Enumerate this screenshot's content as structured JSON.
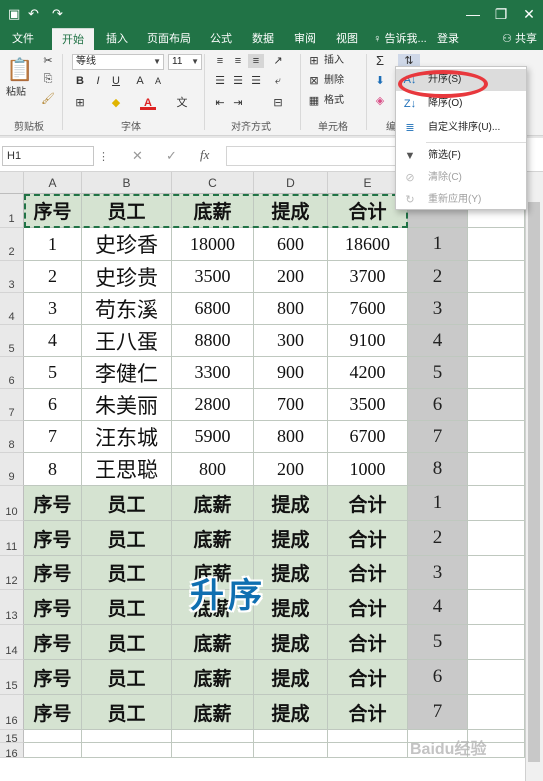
{
  "quick_access": {
    "undo": "↶",
    "redo": "↷",
    "save": "▣"
  },
  "window": {
    "minimize": "—",
    "restore": "❐",
    "close": "✕"
  },
  "tabs": [
    {
      "label": "文件"
    },
    {
      "label": "开始"
    },
    {
      "label": "插入"
    },
    {
      "label": "页面布局"
    },
    {
      "label": "公式"
    },
    {
      "label": "数据"
    },
    {
      "label": "审阅"
    },
    {
      "label": "视图"
    },
    {
      "label": "♀ 告诉我..."
    },
    {
      "label": "登录"
    }
  ],
  "share_label": "⚇ 共享",
  "ribbon": {
    "paste": "粘贴",
    "font_name": "等线",
    "font_size": "11",
    "insert": "插入",
    "delete": "删除",
    "format": "格式",
    "groups": {
      "clipboard": "剪贴板",
      "font": "字体",
      "alignment": "对齐方式",
      "cells": "单元格",
      "editing": "编"
    }
  },
  "formula_bar": {
    "name_box": "H1",
    "fx": "fx",
    "cancel": "✕",
    "enter": "✓"
  },
  "columns": [
    "A",
    "B",
    "C",
    "D",
    "E"
  ],
  "row_numbers": [
    "1",
    "2",
    "3",
    "4",
    "5",
    "6",
    "7",
    "8",
    "9",
    "10",
    "11",
    "12",
    "13",
    "14",
    "15",
    "16",
    "15",
    "16"
  ],
  "table": {
    "headers": [
      "序号",
      "员工",
      "底薪",
      "提成",
      "合计"
    ],
    "rows": [
      [
        "1",
        "史珍香",
        "18000",
        "600",
        "18600"
      ],
      [
        "2",
        "史珍贵",
        "3500",
        "200",
        "3700"
      ],
      [
        "3",
        "苟东溪",
        "6800",
        "800",
        "7600"
      ],
      [
        "4",
        "王八蛋",
        "8800",
        "300",
        "9100"
      ],
      [
        "5",
        "李健仁",
        "3300",
        "900",
        "4200"
      ],
      [
        "6",
        "朱美丽",
        "2800",
        "700",
        "3500"
      ],
      [
        "7",
        "汪东城",
        "5900",
        "800",
        "6700"
      ],
      [
        "8",
        "王思聪",
        "800",
        "200",
        "1000"
      ]
    ],
    "repeat_headers": [
      "序号",
      "员工",
      "底薪",
      "提成",
      "合计"
    ]
  },
  "f_column": [
    "1",
    "2",
    "3",
    "4",
    "5",
    "6",
    "7",
    "8",
    "1",
    "2",
    "3",
    "4",
    "5",
    "6",
    "7"
  ],
  "overlay_text": "升序",
  "sort_menu": {
    "items": [
      {
        "label": "升序(S)",
        "icon": "A↓",
        "state": "highlighted"
      },
      {
        "label": "降序(O)",
        "icon": "Z↓",
        "state": "normal"
      },
      {
        "label": "自定义排序(U)...",
        "icon": "≣",
        "state": "normal"
      },
      {
        "label": "筛选(F)",
        "icon": "▼",
        "state": "normal"
      },
      {
        "label": "清除(C)",
        "icon": "⊘",
        "state": "disabled"
      },
      {
        "label": "重新应用(Y)",
        "icon": "↻",
        "state": "disabled"
      }
    ]
  },
  "colors": {
    "excel_green": "#217346",
    "table_fill": "#d5e3d1",
    "highlight_ring": "#e8383d",
    "overlay_blue": "#0f6fb1"
  },
  "watermark": "Baidu经验"
}
